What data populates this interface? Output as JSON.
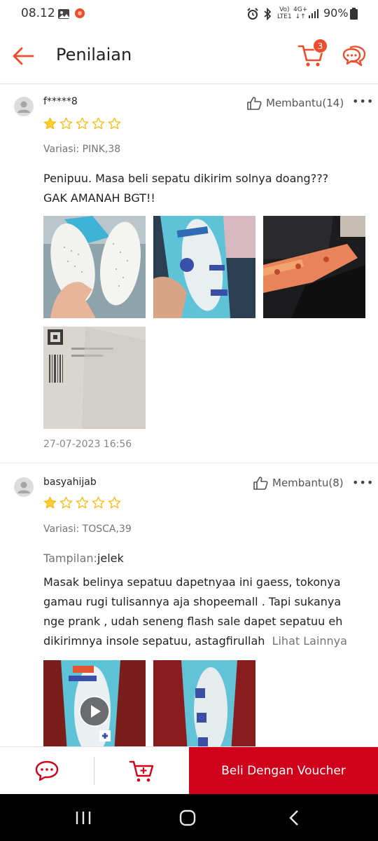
{
  "status_bar": {
    "time": "08.12",
    "network_volte": "Vo)",
    "network_lte": "LTE1",
    "network_4g": "4G+",
    "battery": "90%"
  },
  "header": {
    "title": "Penilaian",
    "cart_count": "3",
    "accent_color": "#ee4d2d"
  },
  "reviews": [
    {
      "name": "f*****8",
      "helpful": "Membantu(14)",
      "rating": 1,
      "max_rating": 5,
      "variation": "Variasi: PINK,38",
      "text_line1": "Penipuu. Masa beli sepatu dikirim solnya doang???",
      "text_line2": "GAK AMANAH BGT!!",
      "photos": [
        "insole-white-held-photo",
        "insole-package-blue-photo",
        "orange-black-fabric-photo",
        "shipping-label-photo"
      ],
      "date": "27-07-2023 16:56"
    },
    {
      "name": "basyahijab",
      "helpful": "Membantu(8)",
      "rating": 1,
      "max_rating": 5,
      "variation": "Variasi: TOSCA,39",
      "attr_key": "Tampilan:",
      "attr_value": "jelek",
      "text_line1": "Masak belinya sepatuu dapetnyaa ini gaess, tokonya",
      "text_line2": "gamau rugi tulisannya aja shopeemall . Tapi sukanya",
      "text_line3": "nge prank , udah seneng flash sale dapet sepatuu eh",
      "text_line4": "dikirimnya insole sepatuu, astagfirullah",
      "see_more": "Lihat Lainnya",
      "photos": [
        "insole-package-video-thumb",
        "insole-package-red-bg-photo"
      ]
    }
  ],
  "bottom_bar": {
    "buy_label": "Beli Dengan Voucher",
    "buy_color": "#d0011b"
  },
  "icons": {
    "back": "arrow-left-icon",
    "cart": "shopping-cart-icon",
    "chat": "chat-bubble-icon",
    "helpful": "thumbs-up-icon",
    "more": "more-horizontal-icon",
    "play": "play-icon",
    "recent_apps": "recent-apps-icon",
    "home": "home-icon",
    "back_nav": "back-nav-icon"
  }
}
